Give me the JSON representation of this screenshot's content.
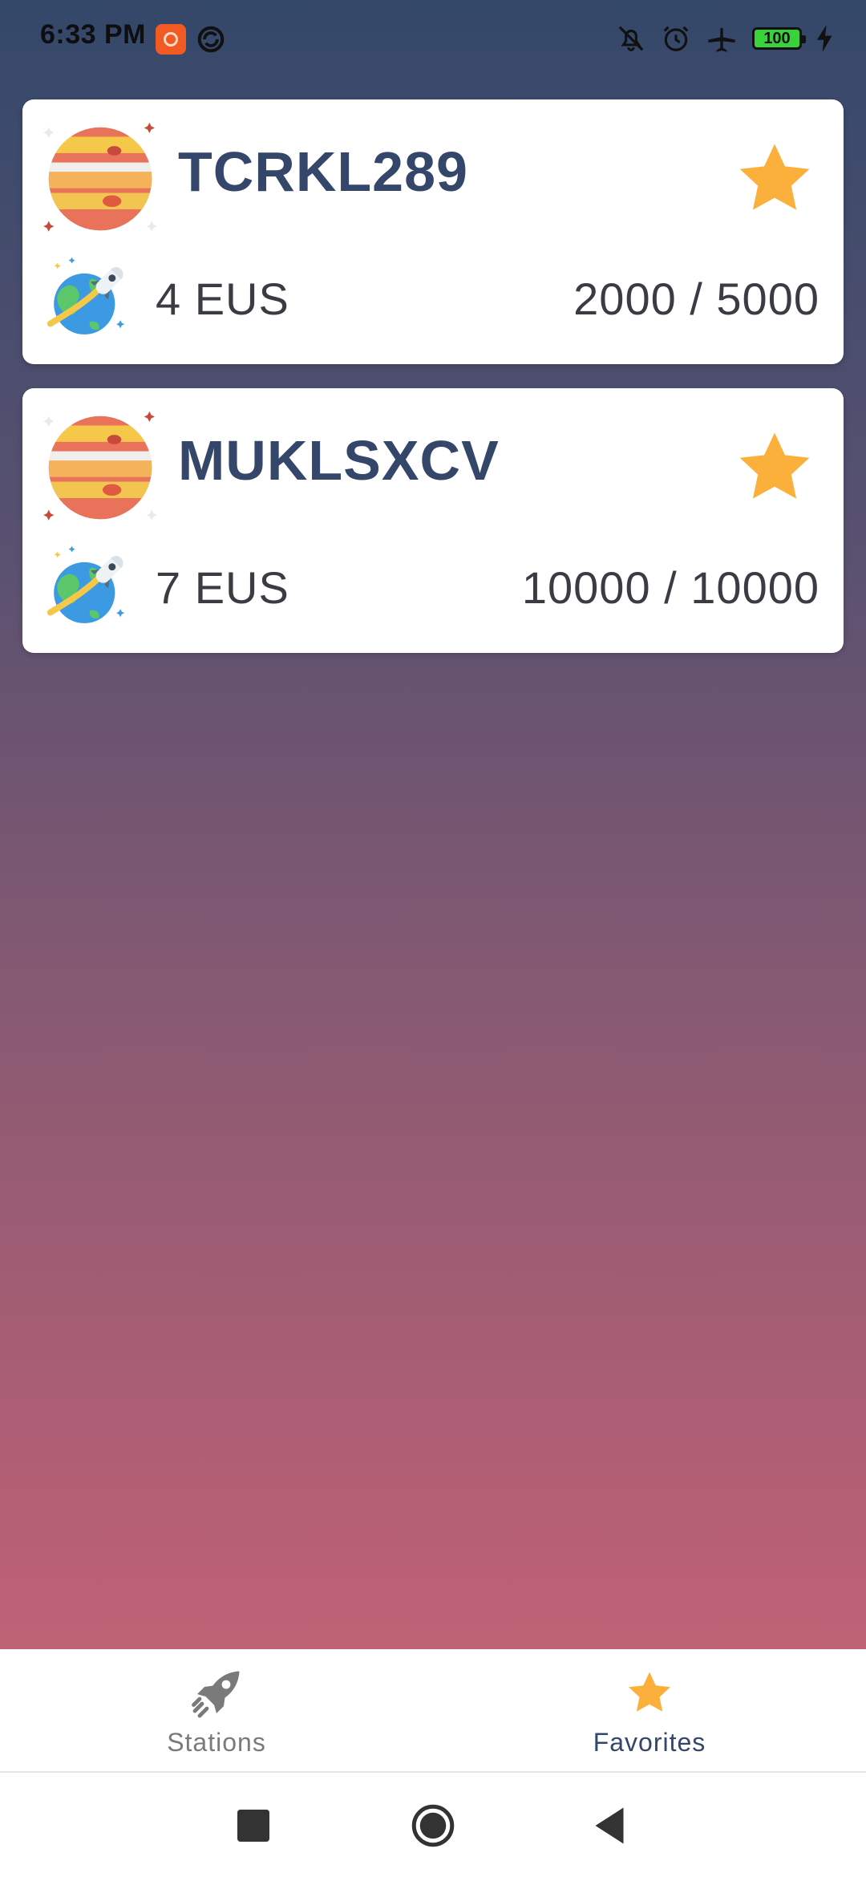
{
  "status_bar": {
    "time": "6:33 PM",
    "battery": "100",
    "icons": [
      "app-notification-icon",
      "sync-icon",
      "mute-icon",
      "alarm-icon",
      "airplane-mode-icon",
      "battery-icon",
      "charging-icon"
    ]
  },
  "stations": [
    {
      "name": "TCRKL289",
      "ships": "4 EUS",
      "capacity": "2000 / 5000",
      "favorite": true
    },
    {
      "name": "MUKLSXCV",
      "ships": "7 EUS",
      "capacity": "10000 / 10000",
      "favorite": true
    }
  ],
  "bottom_nav": {
    "items": [
      {
        "label": "Stations",
        "icon": "rocket-icon",
        "active": false
      },
      {
        "label": "Favorites",
        "icon": "star-icon",
        "active": true
      }
    ]
  },
  "colors": {
    "title": "#34476a",
    "star": "#fbb03b",
    "gradient_top": "#34486a",
    "gradient_bottom": "#d0677a",
    "inactive_nav": "#7a7a7a"
  }
}
